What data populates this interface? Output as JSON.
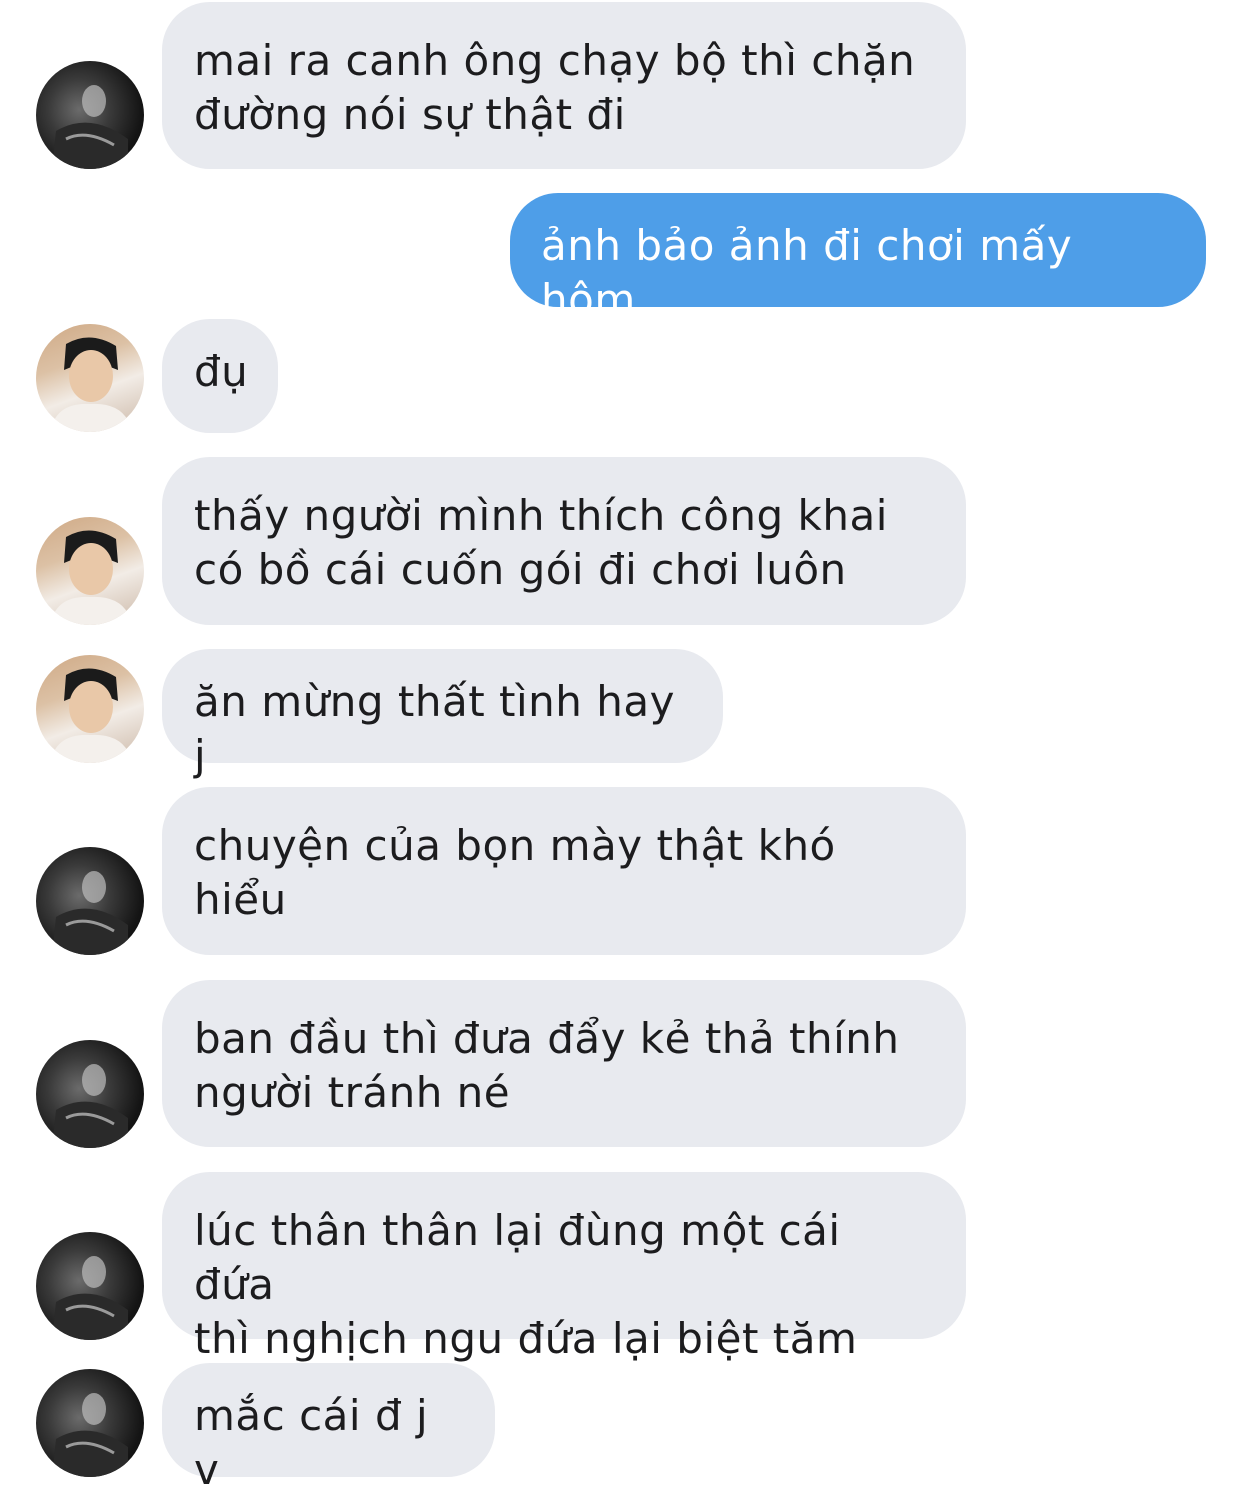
{
  "messages": [
    {
      "text": "mai ra canh ông chạy bộ thì chặn\nđường nói sự thật đi",
      "direction": "incoming",
      "avatar": "dark-avatar"
    },
    {
      "text": "ảnh bảo ảnh đi chơi mấy hôm",
      "direction": "outgoing"
    },
    {
      "text": "đụ",
      "direction": "incoming",
      "avatar": "light-avatar"
    },
    {
      "text": "thấy người mình thích công khai\ncó bồ cái cuốn gói đi chơi luôn",
      "direction": "incoming",
      "avatar": "light-avatar"
    },
    {
      "text": "ăn mừng thất tình hay j",
      "direction": "incoming",
      "avatar": "light-avatar"
    },
    {
      "text": "chuyện của bọn mày thật khó\nhiểu",
      "direction": "incoming",
      "avatar": "dark-avatar"
    },
    {
      "text": "ban đầu thì đưa đẩy kẻ thả thính\nngười tránh né",
      "direction": "incoming",
      "avatar": "dark-avatar"
    },
    {
      "text": "lúc thân thân lại đùng một cái đứa\nthì nghịch ngu đứa lại biệt tăm",
      "direction": "incoming",
      "avatar": "dark-avatar"
    },
    {
      "text": "mắc cái đ j v",
      "direction": "incoming",
      "avatar": "dark-avatar"
    }
  ],
  "colors": {
    "incoming_bubble": "#e8eaef",
    "outgoing_bubble": "#4e9ee8",
    "incoming_text": "#1c1c1e",
    "outgoing_text": "#ffffff"
  }
}
